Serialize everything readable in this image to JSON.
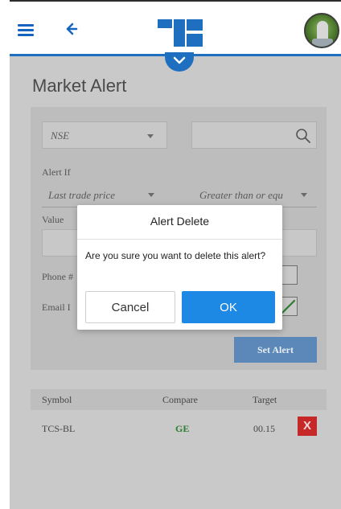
{
  "header": {
    "menu_icon": "hamburger-menu-icon",
    "back_icon": "back-arrow-icon",
    "logo_icon": "app-logo",
    "avatar_icon": "user-avatar",
    "accent_color": "#1e6fbf"
  },
  "page": {
    "title": "Market Alert"
  },
  "form": {
    "exchange_value": "NSE",
    "search_icon": "search-icon",
    "alert_if_label": "Alert If",
    "alert_if_value": "Last trade price",
    "condition_value": "Greater than or equ",
    "value_label": "Value",
    "phone_label": "Phone #",
    "email_label": "Email I",
    "set_alert_label": "Set Alert"
  },
  "table": {
    "columns": [
      "Symbol",
      "Compare",
      "Target"
    ],
    "rows": [
      {
        "symbol": "TCS-BL",
        "compare": "GE",
        "target": "00.15",
        "delete_label": "X"
      }
    ]
  },
  "dialog": {
    "title": "Alert Delete",
    "message": "Are you sure you want to delete this alert?",
    "cancel_label": "Cancel",
    "ok_label": "OK",
    "ok_color": "#1e88e5"
  }
}
